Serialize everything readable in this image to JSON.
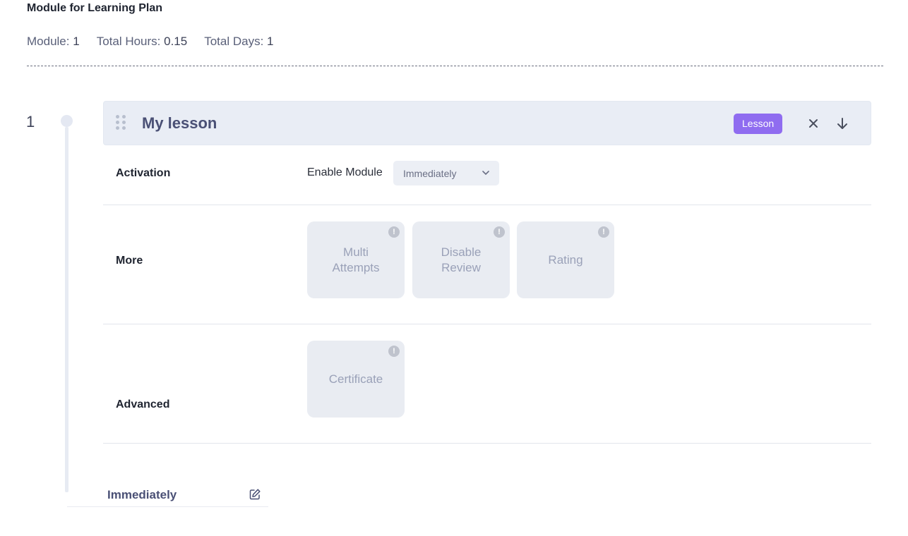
{
  "header": {
    "title": "Module for Learning Plan",
    "stats": [
      {
        "label": "Module:",
        "value": "1"
      },
      {
        "label": "Total Hours:",
        "value": "0.15"
      },
      {
        "label": "Total Days:",
        "value": "1"
      }
    ]
  },
  "module": {
    "index": "1",
    "title": "My lesson",
    "badge": "Lesson",
    "accent_color": "#8f6cf0",
    "icons": {
      "drag": "drag-handle-icon",
      "close": "close-icon",
      "move_down": "arrow-down-icon",
      "edit": "edit-icon",
      "info": "info-icon"
    }
  },
  "sections": {
    "activation": {
      "label": "Activation",
      "enable_label": "Enable Module",
      "select_value": "Immediately"
    },
    "more": {
      "label": "More",
      "tiles": [
        "Multi Attempts",
        "Disable Review",
        "Rating"
      ]
    },
    "advanced": {
      "label": "Advanced",
      "tiles": [
        "Certificate"
      ]
    }
  },
  "footer": {
    "schedule": "Immediately"
  }
}
